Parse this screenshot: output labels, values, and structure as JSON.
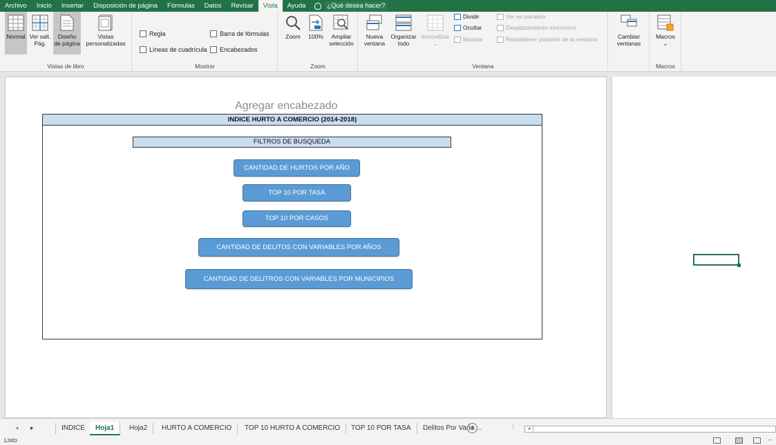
{
  "menu": {
    "tabs": [
      "Archivo",
      "Inicio",
      "Insertar",
      "Disposición de página",
      "Fórmulas",
      "Datos",
      "Revisar",
      "Vista",
      "Ayuda"
    ],
    "active_tab": "Vista",
    "tell_me": "¿Qué desea hacer?"
  },
  "ribbon": {
    "vistas_libro": {
      "label": "Vistas de libro",
      "normal": "Normal",
      "ver_salt_1": "Ver salt.",
      "ver_salt_2": "Pág.",
      "diseno_1": "Diseño",
      "diseno_2": "de página",
      "vistas_1": "Vistas",
      "vistas_2": "personalizadas"
    },
    "mostrar": {
      "label": "Mostrar",
      "regla": "Regla",
      "barra_formulas": "Barra de fórmulas",
      "lineas_cuadricula": "Líneas de cuadrícula",
      "encabezados": "Encabezados"
    },
    "zoom": {
      "label": "Zoom",
      "zoom": "Zoom",
      "pct100": "100%",
      "ampliar_1": "Ampliar",
      "ampliar_2": "selección"
    },
    "ventana": {
      "label": "Ventana",
      "nueva_1": "Nueva",
      "nueva_2": "ventana",
      "organizar_1": "Organizar",
      "organizar_2": "todo",
      "inmovilizar": "Inmovilizar",
      "dividir": "Dividir",
      "ocultar": "Ocultar",
      "mostrar": "Mostrar",
      "ver_paralelo": "Ver en paralelo",
      "desplazamiento": "Desplazamiento sincrónico",
      "restablecer": "Restablecer posición de la ventana",
      "cambiar_1": "Cambiar",
      "cambiar_2": "ventanas"
    },
    "macros": {
      "label": "Macros",
      "macros": "Macros"
    }
  },
  "sheet": {
    "header_placeholder": "Agregar encabezado",
    "title": "INDICE HURTO A COMERCIO (2014-2018)",
    "filters_title": "FILTROS DE BUSQUEDA",
    "buttons": [
      "CANTIDAD DE HURTOS POR AÑO",
      "TOP 10 POR TASA",
      "TOP 10 POR CASOS",
      "CANTIDAD DE DELITOS CON VARIABLES POR AÑOS",
      "CANTIDAD DE DELITROS CON VARIABLES POR MUNICIPIOS"
    ]
  },
  "sheet_tabs": [
    "INDICE",
    "Hoja1",
    "Hoja2",
    "HURTO A COMERCIO",
    "TOP 10 HURTO A COMERCIO",
    "TOP 10 POR TASA",
    "Delitos Por Varia ..."
  ],
  "active_sheet": "Hoja1",
  "status": "Listo",
  "colors": {
    "accent": "#217346",
    "button": "#5b9bd5",
    "header_fill": "#c9ddf1"
  }
}
